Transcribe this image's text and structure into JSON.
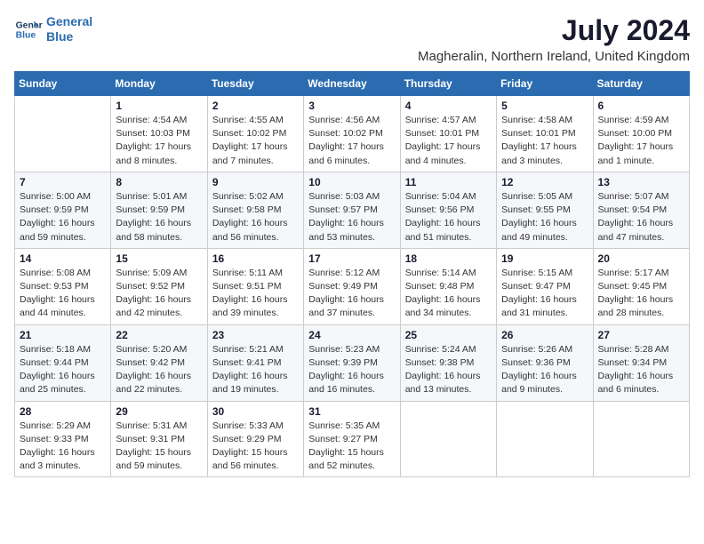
{
  "header": {
    "logo_line1": "General",
    "logo_line2": "Blue",
    "month": "July 2024",
    "location": "Magheralin, Northern Ireland, United Kingdom"
  },
  "weekdays": [
    "Sunday",
    "Monday",
    "Tuesday",
    "Wednesday",
    "Thursday",
    "Friday",
    "Saturday"
  ],
  "weeks": [
    [
      {
        "day": "",
        "info": ""
      },
      {
        "day": "1",
        "info": "Sunrise: 4:54 AM\nSunset: 10:03 PM\nDaylight: 17 hours\nand 8 minutes."
      },
      {
        "day": "2",
        "info": "Sunrise: 4:55 AM\nSunset: 10:02 PM\nDaylight: 17 hours\nand 7 minutes."
      },
      {
        "day": "3",
        "info": "Sunrise: 4:56 AM\nSunset: 10:02 PM\nDaylight: 17 hours\nand 6 minutes."
      },
      {
        "day": "4",
        "info": "Sunrise: 4:57 AM\nSunset: 10:01 PM\nDaylight: 17 hours\nand 4 minutes."
      },
      {
        "day": "5",
        "info": "Sunrise: 4:58 AM\nSunset: 10:01 PM\nDaylight: 17 hours\nand 3 minutes."
      },
      {
        "day": "6",
        "info": "Sunrise: 4:59 AM\nSunset: 10:00 PM\nDaylight: 17 hours\nand 1 minute."
      }
    ],
    [
      {
        "day": "7",
        "info": "Sunrise: 5:00 AM\nSunset: 9:59 PM\nDaylight: 16 hours\nand 59 minutes."
      },
      {
        "day": "8",
        "info": "Sunrise: 5:01 AM\nSunset: 9:59 PM\nDaylight: 16 hours\nand 58 minutes."
      },
      {
        "day": "9",
        "info": "Sunrise: 5:02 AM\nSunset: 9:58 PM\nDaylight: 16 hours\nand 56 minutes."
      },
      {
        "day": "10",
        "info": "Sunrise: 5:03 AM\nSunset: 9:57 PM\nDaylight: 16 hours\nand 53 minutes."
      },
      {
        "day": "11",
        "info": "Sunrise: 5:04 AM\nSunset: 9:56 PM\nDaylight: 16 hours\nand 51 minutes."
      },
      {
        "day": "12",
        "info": "Sunrise: 5:05 AM\nSunset: 9:55 PM\nDaylight: 16 hours\nand 49 minutes."
      },
      {
        "day": "13",
        "info": "Sunrise: 5:07 AM\nSunset: 9:54 PM\nDaylight: 16 hours\nand 47 minutes."
      }
    ],
    [
      {
        "day": "14",
        "info": "Sunrise: 5:08 AM\nSunset: 9:53 PM\nDaylight: 16 hours\nand 44 minutes."
      },
      {
        "day": "15",
        "info": "Sunrise: 5:09 AM\nSunset: 9:52 PM\nDaylight: 16 hours\nand 42 minutes."
      },
      {
        "day": "16",
        "info": "Sunrise: 5:11 AM\nSunset: 9:51 PM\nDaylight: 16 hours\nand 39 minutes."
      },
      {
        "day": "17",
        "info": "Sunrise: 5:12 AM\nSunset: 9:49 PM\nDaylight: 16 hours\nand 37 minutes."
      },
      {
        "day": "18",
        "info": "Sunrise: 5:14 AM\nSunset: 9:48 PM\nDaylight: 16 hours\nand 34 minutes."
      },
      {
        "day": "19",
        "info": "Sunrise: 5:15 AM\nSunset: 9:47 PM\nDaylight: 16 hours\nand 31 minutes."
      },
      {
        "day": "20",
        "info": "Sunrise: 5:17 AM\nSunset: 9:45 PM\nDaylight: 16 hours\nand 28 minutes."
      }
    ],
    [
      {
        "day": "21",
        "info": "Sunrise: 5:18 AM\nSunset: 9:44 PM\nDaylight: 16 hours\nand 25 minutes."
      },
      {
        "day": "22",
        "info": "Sunrise: 5:20 AM\nSunset: 9:42 PM\nDaylight: 16 hours\nand 22 minutes."
      },
      {
        "day": "23",
        "info": "Sunrise: 5:21 AM\nSunset: 9:41 PM\nDaylight: 16 hours\nand 19 minutes."
      },
      {
        "day": "24",
        "info": "Sunrise: 5:23 AM\nSunset: 9:39 PM\nDaylight: 16 hours\nand 16 minutes."
      },
      {
        "day": "25",
        "info": "Sunrise: 5:24 AM\nSunset: 9:38 PM\nDaylight: 16 hours\nand 13 minutes."
      },
      {
        "day": "26",
        "info": "Sunrise: 5:26 AM\nSunset: 9:36 PM\nDaylight: 16 hours\nand 9 minutes."
      },
      {
        "day": "27",
        "info": "Sunrise: 5:28 AM\nSunset: 9:34 PM\nDaylight: 16 hours\nand 6 minutes."
      }
    ],
    [
      {
        "day": "28",
        "info": "Sunrise: 5:29 AM\nSunset: 9:33 PM\nDaylight: 16 hours\nand 3 minutes."
      },
      {
        "day": "29",
        "info": "Sunrise: 5:31 AM\nSunset: 9:31 PM\nDaylight: 15 hours\nand 59 minutes."
      },
      {
        "day": "30",
        "info": "Sunrise: 5:33 AM\nSunset: 9:29 PM\nDaylight: 15 hours\nand 56 minutes."
      },
      {
        "day": "31",
        "info": "Sunrise: 5:35 AM\nSunset: 9:27 PM\nDaylight: 15 hours\nand 52 minutes."
      },
      {
        "day": "",
        "info": ""
      },
      {
        "day": "",
        "info": ""
      },
      {
        "day": "",
        "info": ""
      }
    ]
  ]
}
